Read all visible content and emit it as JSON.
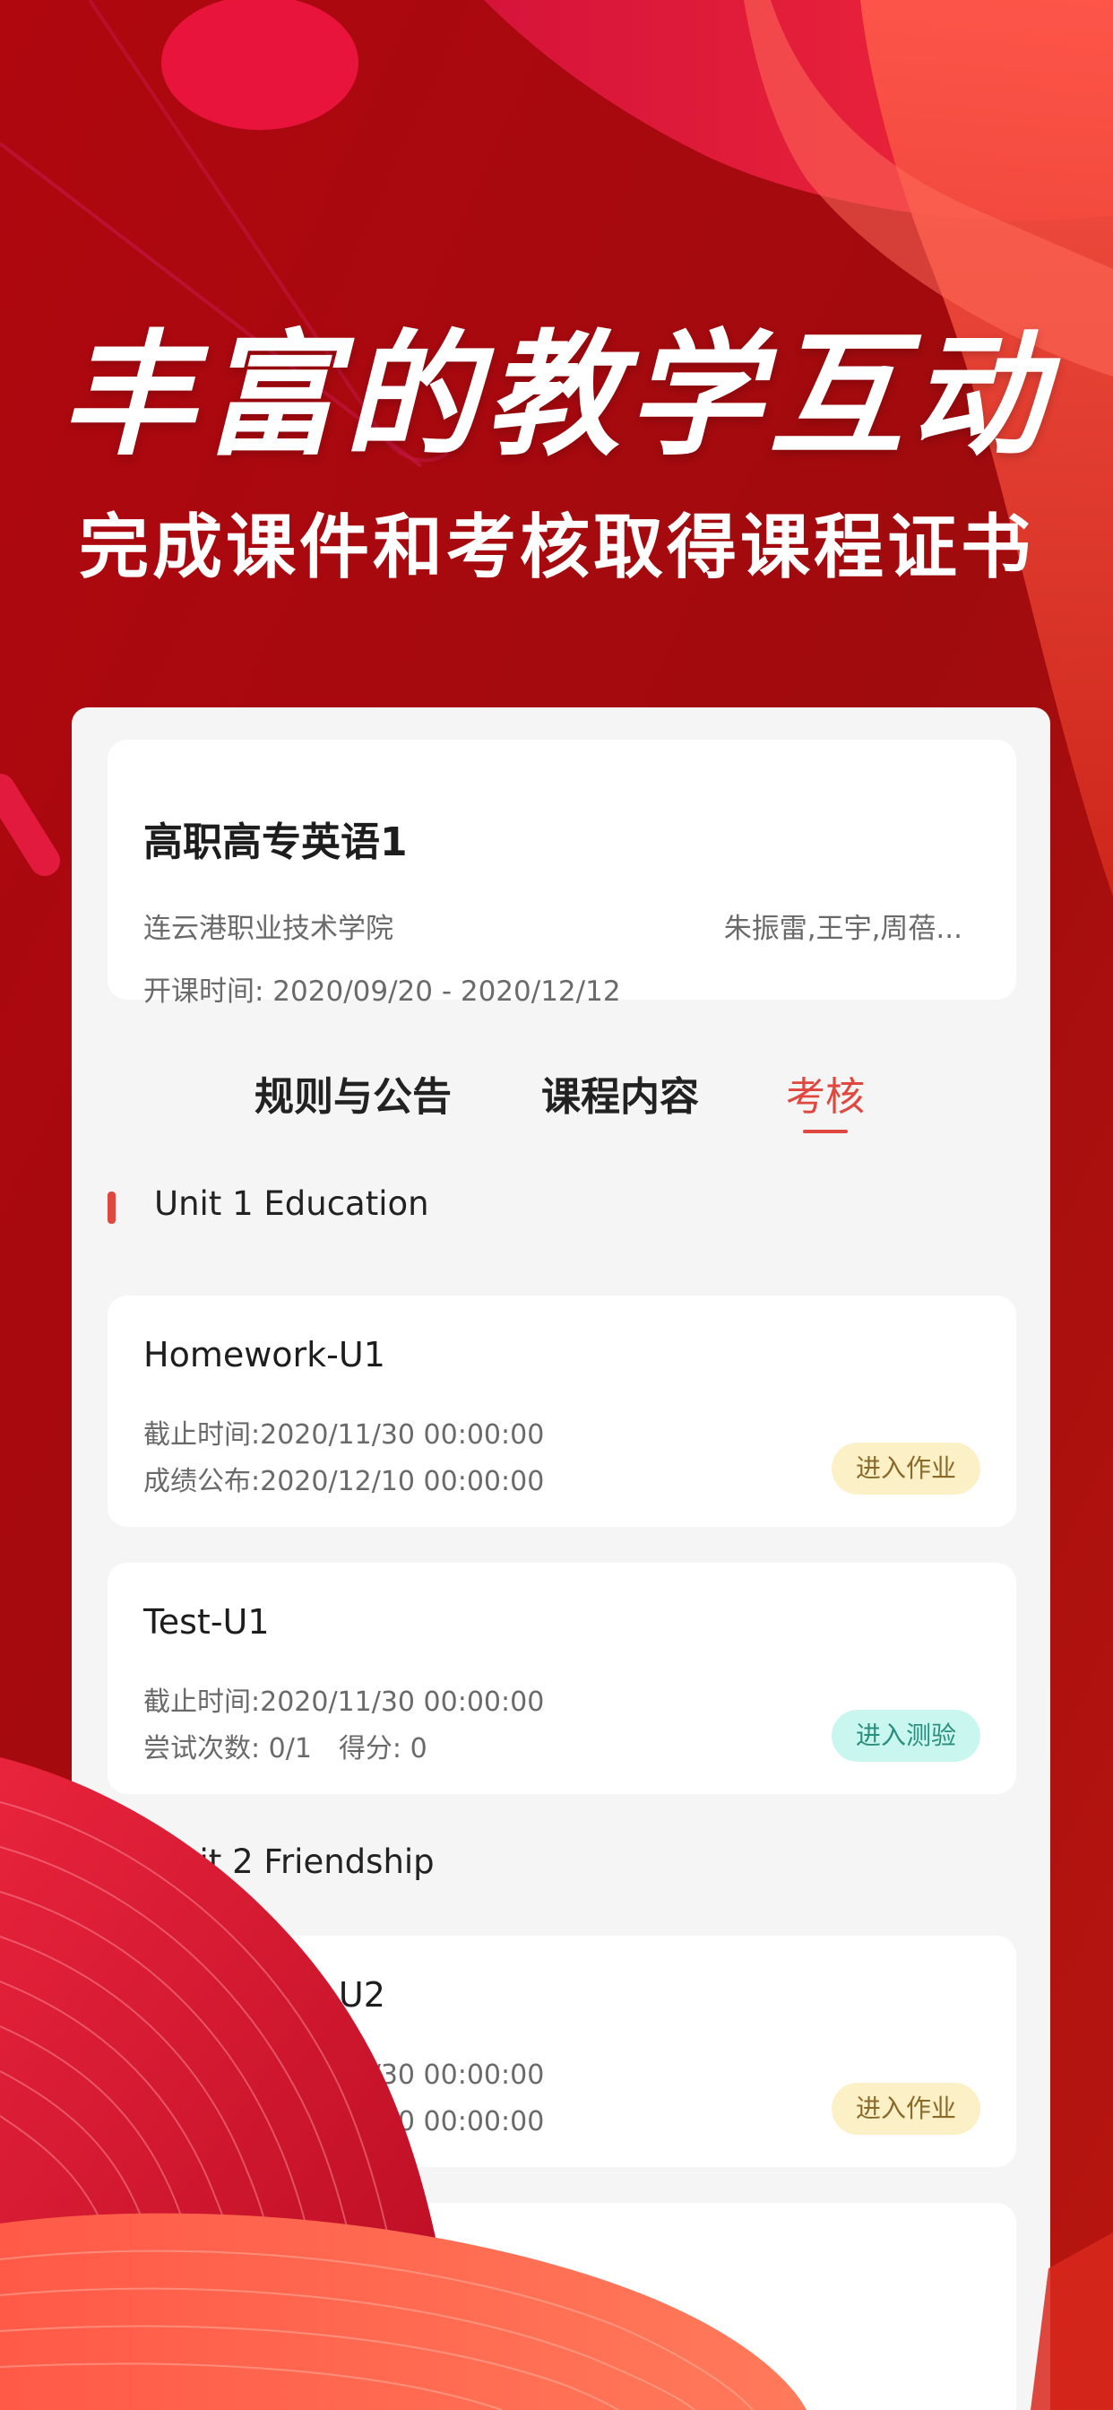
{
  "hero": {
    "headline": "丰富的教学互动",
    "subline": "完成课件和考核取得课程证书"
  },
  "colors": {
    "background": "#a70c10",
    "accent": "#e0483f",
    "homework_button_bg": "#fcf0c6",
    "quiz_button_bg": "#c9f6ee"
  },
  "course": {
    "title": "高职高专英语1",
    "school": "连云港职业技术学院",
    "teachers": "朱振雷,王宇,周蓓...",
    "time": "开课时间: 2020/09/20 - 2020/12/12"
  },
  "tabs": [
    {
      "label": "规则与公告",
      "active": false
    },
    {
      "label": "课程内容",
      "active": false
    },
    {
      "label": "考核",
      "active": true
    }
  ],
  "units": [
    {
      "name": "Unit 1 Education",
      "tasks": [
        {
          "title": "Homework-U1",
          "line1": "截止时间:2020/11/30 00:00:00",
          "line2": "成绩公布:2020/12/10 00:00:00",
          "button": "进入作业"
        },
        {
          "title": "Test-U1",
          "line1": "截止时间:2020/11/30 00:00:00",
          "attempts": "尝试次数: 0/1",
          "score": "得分: 0",
          "button": "进入测验"
        }
      ]
    },
    {
      "name": "Unit 2 Friendship",
      "tasks": [
        {
          "title": "Homework-U2",
          "line1": "截止时间:2020/11/30 00:00:00",
          "line2": "成绩公布:2020/12/10 00:00:00",
          "button": "进入作业"
        }
      ]
    }
  ]
}
